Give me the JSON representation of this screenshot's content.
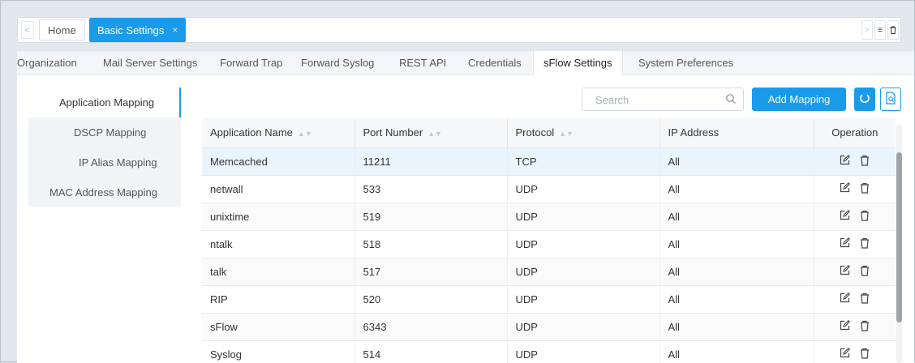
{
  "tabs": {
    "home": "Home",
    "active": "Basic Settings",
    "close": "×"
  },
  "subtabs": [
    "Organization",
    "Mail Server Settings",
    "Forward Trap",
    "Forward Syslog",
    "REST API",
    "Credentials",
    "sFlow Settings",
    "System Preferences"
  ],
  "left_menu": [
    "Application Mapping",
    "DSCP Mapping",
    "IP Alias Mapping",
    "MAC Address Mapping"
  ],
  "toolbar": {
    "search_placeholder": "Search",
    "add_label": "Add Mapping"
  },
  "table": {
    "headers": [
      "Application Name",
      "Port Number",
      "Protocol",
      "IP Address",
      "Operation"
    ],
    "rows": [
      {
        "name": "Memcached",
        "port": "11211",
        "protocol": "TCP",
        "ip": "All"
      },
      {
        "name": "netwall",
        "port": "533",
        "protocol": "UDP",
        "ip": "All"
      },
      {
        "name": "unixtime",
        "port": "519",
        "protocol": "UDP",
        "ip": "All"
      },
      {
        "name": "ntalk",
        "port": "518",
        "protocol": "UDP",
        "ip": "All"
      },
      {
        "name": "talk",
        "port": "517",
        "protocol": "UDP",
        "ip": "All"
      },
      {
        "name": "RIP",
        "port": "520",
        "protocol": "UDP",
        "ip": "All"
      },
      {
        "name": "sFlow",
        "port": "6343",
        "protocol": "UDP",
        "ip": "All"
      },
      {
        "name": "Syslog",
        "port": "514",
        "protocol": "UDP",
        "ip": "All"
      }
    ]
  },
  "colors": {
    "accent": "#1a9bea",
    "row_highlight": "#eaf4fd"
  },
  "icons": {
    "edit": "edit-icon",
    "delete": "trash-icon",
    "search": "search-icon",
    "refresh": "refresh-icon",
    "export": "export-icon"
  }
}
